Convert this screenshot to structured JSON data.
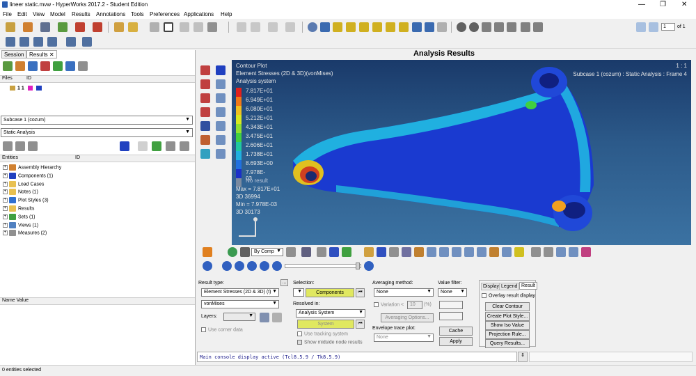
{
  "window": {
    "title": "lineer static.mvw - HyperWorks 2017.2 - Student Edition",
    "minimize": "—",
    "maximize": "❐",
    "close": "✕"
  },
  "menu": [
    "File",
    "Edit",
    "View",
    "Model",
    "Results",
    "Annotations",
    "Tools",
    "Preferences",
    "Applications",
    "Help"
  ],
  "page_nav": {
    "value": "1",
    "suffix": "of 1"
  },
  "left": {
    "tabs": [
      "Session",
      "Results"
    ],
    "files_header": "Files",
    "files_cols": "ID",
    "file_row": "1  1",
    "subcase": "Subcase 1 (cozum)",
    "analysis": "Static Analysis",
    "entities_header": "Entities",
    "entities_cols": "ID",
    "tree": [
      "Assembly Hierarchy",
      "Components (1)",
      "Load Cases",
      "Notes (1)",
      "Plot Styles (3)",
      "Results",
      "Sets (1)",
      "Views (1)",
      "Measures (2)"
    ],
    "name_value_header": "Name Value"
  },
  "viewport": {
    "header": "Analysis Results",
    "plot_title": "Contour Plot",
    "plot_sub": "Element Stresses (2D & 3D)(vonMises)",
    "plot_sys": "Analysis system",
    "scale": "1 : 1",
    "subcase_info": "Subcase 1 (cozum) : Static Analysis : Frame 4",
    "legend": [
      "7.817E+01",
      "6.949E+01",
      "6.080E+01",
      "5.212E+01",
      "4.343E+01",
      "3.475E+01",
      "2.606E+01",
      "1.738E+01",
      "8.693E+00",
      "7.978E-03"
    ],
    "legend_colors": [
      "#e0201c",
      "#f07818",
      "#f0c020",
      "#d8e820",
      "#90e030",
      "#40d040",
      "#20c8a0",
      "#20b0e0",
      "#2070e0",
      "#1a30c8"
    ],
    "no_result": "No result",
    "max": "Max = 7.817E+01",
    "max_id": "3D 36994",
    "min": "Min = 7.978E-03",
    "min_id": "3D 30173"
  },
  "bottom": {
    "result_type_label": "Result type:",
    "result_type": "Element Stresses (2D & 3D) (t)",
    "component": "vonMises",
    "layers_label": "Layers:",
    "use_corner": "Use corner data",
    "selection_label": "Selection:",
    "components_btn": "Components",
    "resolved_label": "Resolved in:",
    "resolved": "Analysis System",
    "system_btn": "System",
    "use_tracking": "Use tracking system",
    "show_midside": "Show midside node results",
    "averaging_label": "Averaging method:",
    "averaging": "None",
    "variation_label": "Variation <",
    "variation_val": "10",
    "variation_unit": "(%)",
    "averaging_opts": "Averaging Options...",
    "envelope_label": "Envelope trace plot:",
    "envelope": "None",
    "value_filter_label": "Value filter:",
    "value_filter": "None",
    "cache": "Cache",
    "apply": "Apply",
    "rtabs": [
      "Display",
      "Legend",
      "Result"
    ],
    "overlay": "Overlay result display",
    "clear": "Clear Contour",
    "create_style": "Create Plot Style...",
    "show_iso": "Show Iso Value",
    "projection": "Projection Rule...",
    "query": "Query Results..."
  },
  "comp_select": "By Comp",
  "console": "Main console display active (Tcl8.5.9 / Tk8.5.9)",
  "status": "0 entities selected"
}
